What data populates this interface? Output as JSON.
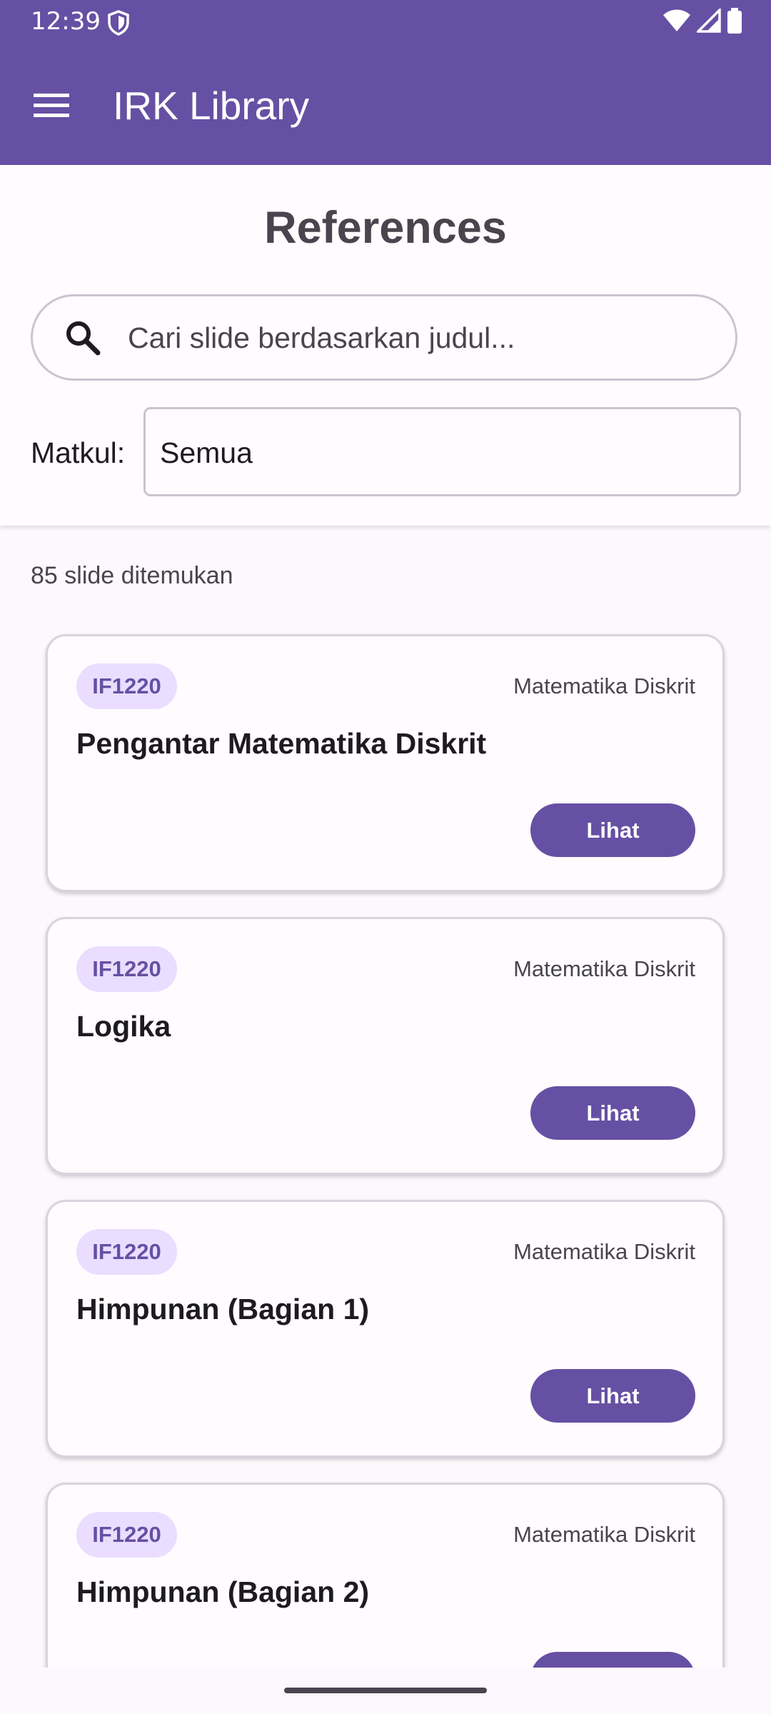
{
  "status_bar": {
    "time": "12:39",
    "icons": [
      "shield-icon",
      "wifi-icon",
      "cellular-signal-icon",
      "battery-icon"
    ]
  },
  "app_bar": {
    "title": "IRK Library",
    "menu_icon": "hamburger-menu-icon"
  },
  "page": {
    "title": "References"
  },
  "search": {
    "placeholder": "Cari slide berdasarkan judul...",
    "value": "",
    "icon": "search-icon"
  },
  "filter": {
    "label": "Matkul:",
    "selected": "Semua"
  },
  "results": {
    "count_text": "85 slide ditemukan"
  },
  "cards": [
    {
      "code": "IF1220",
      "course": "Matematika Diskrit",
      "title": "Pengantar Matematika Diskrit",
      "button": "Lihat"
    },
    {
      "code": "IF1220",
      "course": "Matematika Diskrit",
      "title": "Logika",
      "button": "Lihat"
    },
    {
      "code": "IF1220",
      "course": "Matematika Diskrit",
      "title": "Himpunan (Bagian 1)",
      "button": "Lihat"
    },
    {
      "code": "IF1220",
      "course": "Matematika Diskrit",
      "title": "Himpunan (Bagian 2)",
      "button": "Lihat"
    }
  ],
  "colors": {
    "primary": "#6650a4",
    "badge_background": "#eaddff",
    "background": "#fcf8fd",
    "outline": "#cac4d0"
  }
}
